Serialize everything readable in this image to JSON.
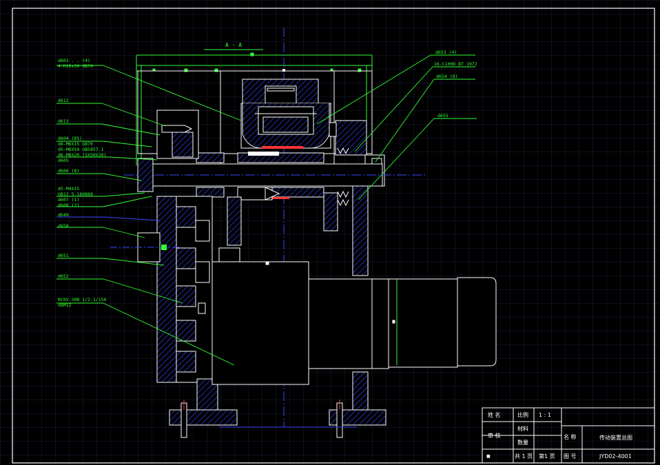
{
  "section_title": "A - A",
  "callouts_left": [
    {
      "text": "d601 . . (4)"
    },
    {
      "text": "4-M10x50 GB70"
    },
    {
      "text": "d612"
    },
    {
      "text": "d613"
    },
    {
      "text": "d604 (D5)"
    },
    {
      "text": "d8-M6X15 GB70"
    },
    {
      "text": "d5-M6X50 GB5857.1"
    },
    {
      "text": "d6-M8X20 (5X50X20)"
    },
    {
      "text": "d605"
    },
    {
      "text": "d606 (8)"
    },
    {
      "text": "d5-M4X15"
    },
    {
      "text": "GB12 5-180888"
    },
    {
      "text": "d607 (1)"
    },
    {
      "text": "d608 (2)"
    },
    {
      "text": "d649"
    },
    {
      "text": "d650"
    },
    {
      "text": "d651"
    },
    {
      "text": "d652"
    },
    {
      "text": "RC0V-30B 1/2-1/150"
    },
    {
      "text": "d8M12"
    }
  ],
  "callouts_right": [
    {
      "text": "d653 (4)"
    },
    {
      "text": "16-C100D BT 1972"
    },
    {
      "text": "d654 (8)"
    },
    {
      "text": "d655"
    }
  ],
  "title_block": {
    "row1": {
      "name_label": "姓 名",
      "scale_label": "比例",
      "scale_value": "1 : 1"
    },
    "row2": {
      "material_label": "材料"
    },
    "row3": {
      "review_label": "审 核",
      "quantity_label": "数量",
      "title_label": "名 称",
      "title_value": "传动装置总图"
    },
    "row4": {
      "corner_mark": "■",
      "sheets_total": "共 1 页",
      "sheet_current": "第1 页",
      "drawing_no_label": "图 号",
      "drawing_no_value": "JYD02-4001"
    }
  },
  "colors": {
    "background": "#000000",
    "grid": "#1c1c3a",
    "frame": "#ffffff",
    "outline": "#ffffff",
    "section_hatch": "#3a46ff",
    "dimension": "#33ff33",
    "centerline": "#3a46ff",
    "accent": "#ff3333",
    "highlight": "#ffff33"
  }
}
